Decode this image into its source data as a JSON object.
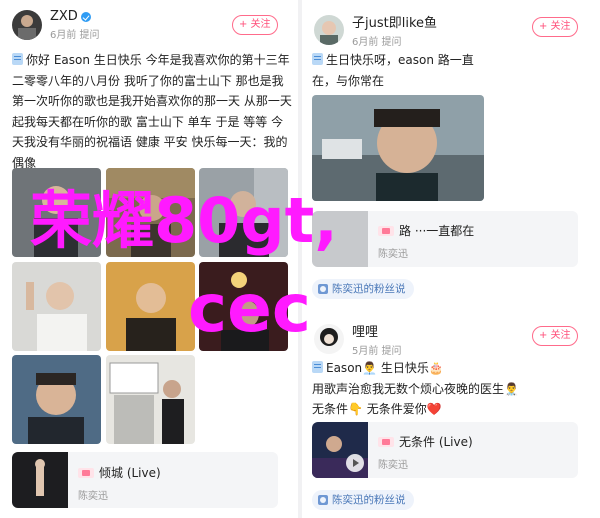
{
  "left_post": {
    "username": "ZXD",
    "meta": "6月前 提问",
    "follow_label": "+ 关注",
    "text": "你好 Eason 生日快乐 今年是我喜欢你的第十三年 二零零八年的八月份 我听了你的富士山下 那也是我第一次听你的歌也是我开始喜欢你的那一天 从那一天起我每天都在听你的歌 富士山下 单车 于是 等等 今天我没有华丽的祝福语 健康 平安 快乐每一天：我的偶像",
    "music": {
      "title": "倾城 (Live)",
      "artist": "陈奕迅"
    }
  },
  "right_post_1": {
    "username": "子just即like鱼",
    "meta": "6月前 提问",
    "follow_label": "+ 关注",
    "text": "生日快乐呀，eason 路一直在，与你常在",
    "music": {
      "title": "路 ···一直都在",
      "artist": "陈奕迅"
    },
    "fan_label": "陈奕迅的粉丝说"
  },
  "right_post_2": {
    "username": "哩哩",
    "meta": "5月前 提问",
    "follow_label": "+ 关注",
    "text_line1": "Eason👨‍💼 生日快乐🎂",
    "text_line2": "用歌声治愈我无数个烦心夜晚的医生👨‍⚕️",
    "text_line3": "无条件👇 无条件爱你❤️",
    "music": {
      "title": "无条件 (Live)",
      "artist": "陈奕迅"
    },
    "fan_label": "陈奕迅的粉丝说"
  },
  "watermark": {
    "line1": "荣耀80gt,",
    "line2": "cec"
  },
  "colors": {
    "accent": "#ff4f7a",
    "watermark": "#ff1aff",
    "link": "#4a78b8",
    "verified": "#2f9cf4"
  }
}
